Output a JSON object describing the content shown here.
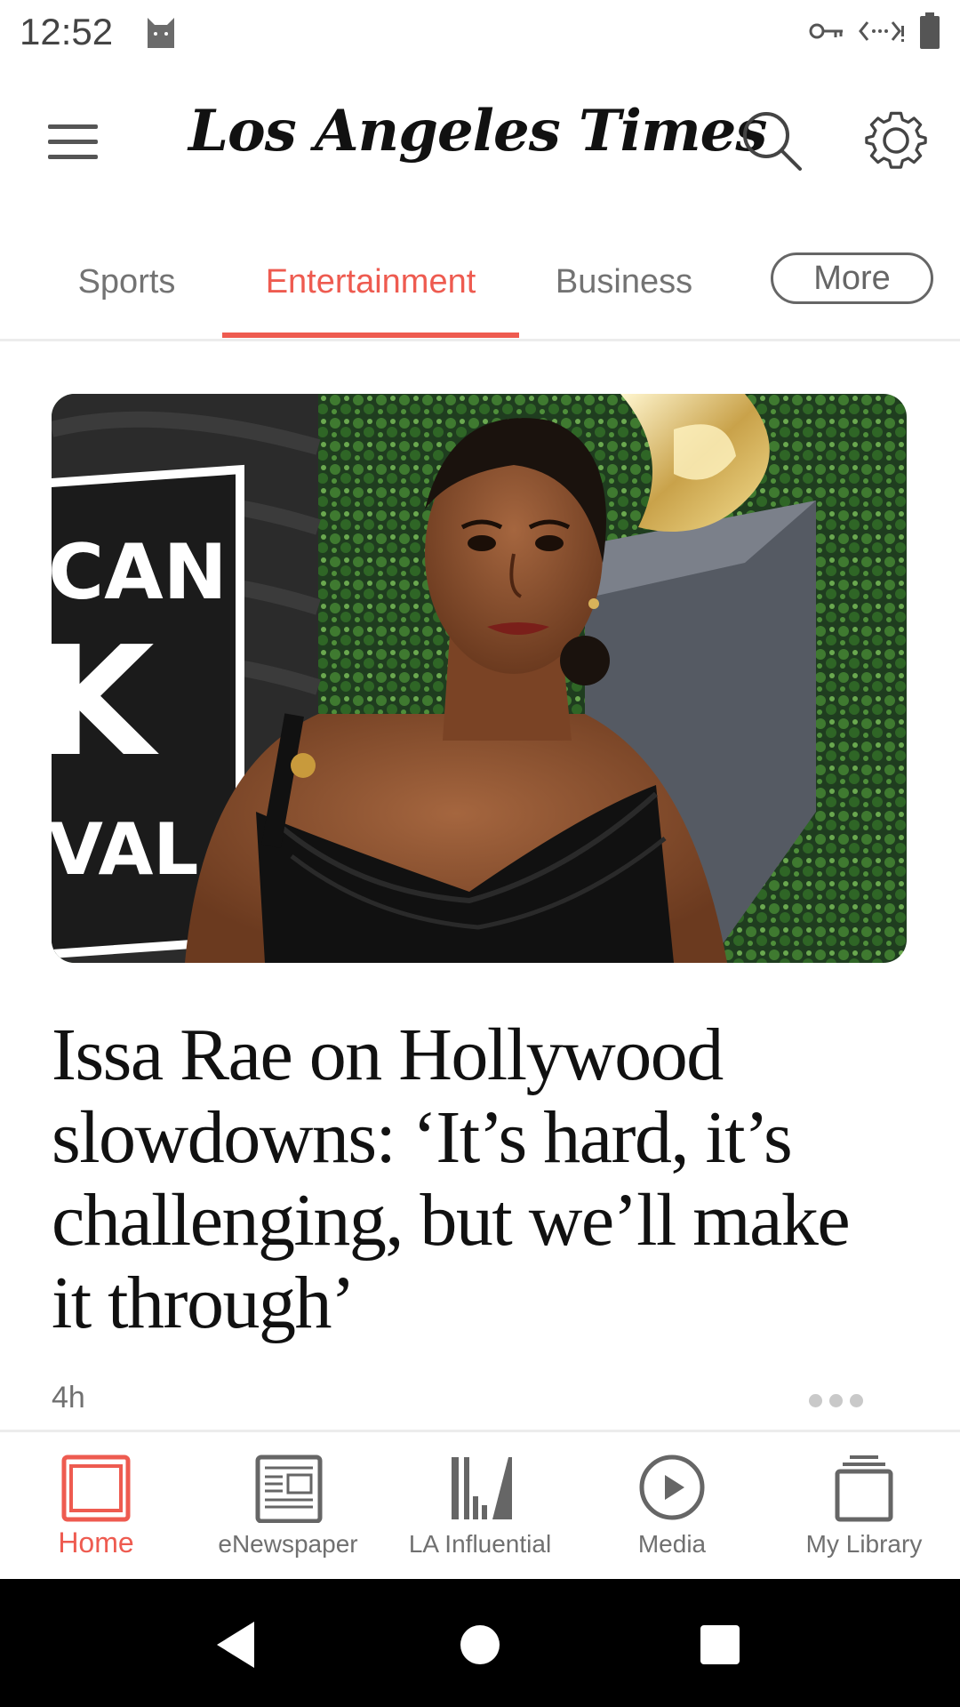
{
  "status_bar": {
    "time": "12:52",
    "icons": [
      "cat-icon",
      "vpn-key-icon",
      "data-saver-icon",
      "battery-icon"
    ]
  },
  "header": {
    "logo_text": "Los Angeles Times",
    "icons": [
      "menu-icon",
      "search-icon",
      "settings-gear-icon"
    ]
  },
  "tabs": [
    {
      "label": "Sports",
      "active": false
    },
    {
      "label": "Entertainment",
      "active": true
    },
    {
      "label": "Business",
      "active": false
    },
    {
      "label": "More",
      "active": false
    }
  ],
  "article": {
    "headline": "Issa Rae on Hollywood slowdowns: ‘It’s hard, it’s challenging, but we’ll make it through’",
    "time_ago": "4h",
    "image_alt_text": "",
    "background_letters": [
      "CAN",
      "K",
      "VAL"
    ]
  },
  "bottom_nav": [
    {
      "label": "Home",
      "icon": "home-window-icon",
      "active": true
    },
    {
      "label": "eNewspaper",
      "icon": "newspaper-icon",
      "active": false
    },
    {
      "label": "LA Influential",
      "icon": "la-influential-icon",
      "active": false
    },
    {
      "label": "Media",
      "icon": "play-circle-icon",
      "active": false
    },
    {
      "label": "My Library",
      "icon": "library-stack-icon",
      "active": false
    }
  ],
  "system_nav": [
    "back-icon",
    "home-circle-icon",
    "recents-square-icon"
  ],
  "colors": {
    "accent": "#ee5b50",
    "inactive_text": "#737373",
    "headline": "#111111",
    "system_bar": "#000000"
  }
}
